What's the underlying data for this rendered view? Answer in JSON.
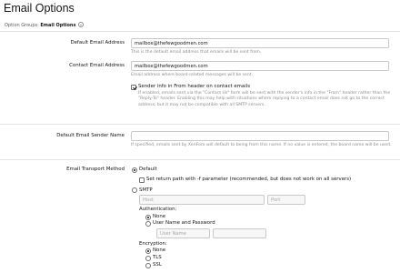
{
  "page_title": "Email Options",
  "option_groups": {
    "label": "Option Groups:",
    "selected": "Email Options"
  },
  "default_email": {
    "label": "Default Email Address",
    "value": "mailbox@thefewgoodmen.com",
    "hint": "This is the default email address that emails will be sent from."
  },
  "contact_email": {
    "label": "Contact Email Address",
    "value": "mailbox@thefewgoodmen.com",
    "hint": "Email address where board-related messages will be sent.",
    "sender_checkbox": {
      "label": "Sender info in From header on contact emails",
      "checked": true,
      "hint_lines": [
        "If enabled, emails sent via the \"Contact Us\" form will be sent with the sender's info in the \"From\" header rather than the",
        "\"Reply-To\" header. Enabling this may help with situations where replying to a contact email does not go to the correct",
        "address, but it may not be compatible with all SMTP servers."
      ]
    }
  },
  "sender_name": {
    "label": "Default Email Sender Name",
    "value": "",
    "hint": "If specified, emails sent by XenForo will default to being from this name. If no value is entered, the board name will be used."
  },
  "transport": {
    "label": "Email Transport Method",
    "default_option": {
      "label": "Default",
      "selected": true
    },
    "return_path": {
      "label": "Set return path with -f parameter (recommended, but does not work on all servers)",
      "checked": false
    },
    "smtp_option": {
      "label": "SMTP",
      "selected": false
    },
    "host_placeholder": "Host",
    "port_placeholder": "Port",
    "authentication": {
      "label": "Authentication:",
      "options": [
        {
          "label": "None",
          "selected": true
        },
        {
          "label": "User Name and Password",
          "selected": false
        }
      ],
      "username_placeholder": "User Name",
      "password_value": ""
    },
    "encryption": {
      "label": "Encryption:",
      "options": [
        {
          "label": "None",
          "selected": true
        },
        {
          "label": "TLS",
          "selected": false
        },
        {
          "label": "SSL",
          "selected": false
        }
      ]
    }
  }
}
